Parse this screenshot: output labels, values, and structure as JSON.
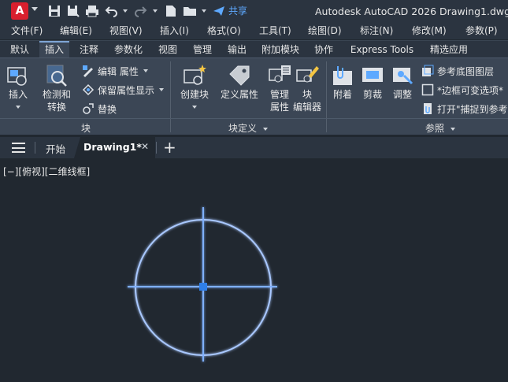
{
  "app": {
    "badge": "A",
    "title": "Autodesk AutoCAD 2026   Drawing1.dwg",
    "share_label": "共享"
  },
  "menu": [
    "文件(F)",
    "编辑(E)",
    "视图(V)",
    "插入(I)",
    "格式(O)",
    "工具(T)",
    "绘图(D)",
    "标注(N)",
    "修改(M)",
    "参数(P)"
  ],
  "ribbon_tabs": [
    "默认",
    "插入",
    "注释",
    "参数化",
    "视图",
    "管理",
    "输出",
    "附加模块",
    "协作",
    "Express Tools",
    "精选应用"
  ],
  "active_tab": "插入",
  "panels": {
    "block": {
      "label": "块",
      "insert": "插入",
      "detect": [
        "检测和",
        "转换"
      ],
      "edit_attr": "编辑 属性",
      "retain_attr": "保留属性显示",
      "replace": "替换"
    },
    "block_def": {
      "label": "块定义",
      "create": "创建块",
      "define_attr": "定义属性",
      "manage": [
        "管理",
        "属性"
      ],
      "editor": [
        "块",
        "编辑器"
      ]
    },
    "reference": {
      "label": "参照",
      "attach": "附着",
      "clip": "剪裁",
      "adjust": "调整",
      "underlay_layers": "参考底图图层",
      "frames": "*边框可变选项*",
      "snap": "打开\"捕捉到参考"
    }
  },
  "file_tabs": {
    "start": "开始",
    "active": "Drawing1*"
  },
  "viewport_label": "[−][俯视][二维线框]",
  "colors": {
    "accent": "#5ea9ff",
    "drawing": "#a9c8ff",
    "app_red": "#d81f2e",
    "canvas_bg": "#212830"
  }
}
